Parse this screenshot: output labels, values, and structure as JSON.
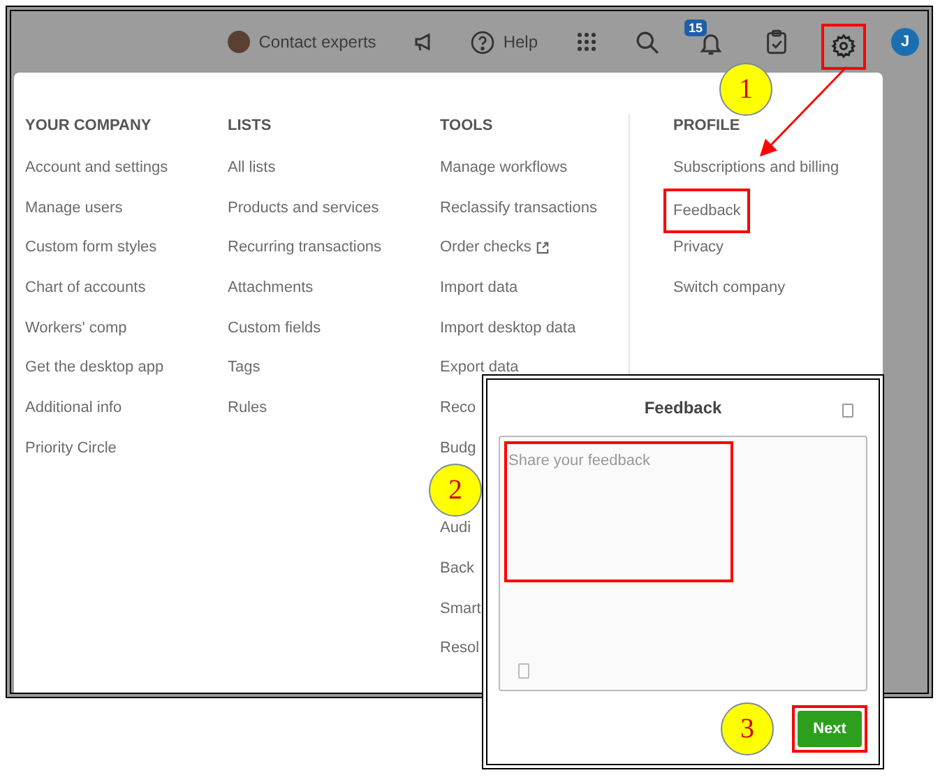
{
  "top_bar": {
    "contact_label": "Contact experts",
    "help_label": "Help",
    "notification_count": "15",
    "avatar_initial": "J"
  },
  "menu": {
    "columns": [
      {
        "heading": "YOUR COMPANY",
        "items": [
          {
            "label": "Account and settings"
          },
          {
            "label": "Manage users"
          },
          {
            "label": "Custom form styles"
          },
          {
            "label": "Chart of accounts"
          },
          {
            "label": "Workers' comp"
          },
          {
            "label": "Get the desktop app"
          },
          {
            "label": "Additional info"
          },
          {
            "label": "Priority Circle"
          }
        ]
      },
      {
        "heading": "LISTS",
        "items": [
          {
            "label": "All lists"
          },
          {
            "label": "Products and services"
          },
          {
            "label": "Recurring transactions"
          },
          {
            "label": "Attachments"
          },
          {
            "label": "Custom fields"
          },
          {
            "label": "Tags"
          },
          {
            "label": "Rules"
          }
        ]
      },
      {
        "heading": "TOOLS",
        "items": [
          {
            "label": "Manage workflows"
          },
          {
            "label": "Reclassify transactions"
          },
          {
            "label": "Order checks",
            "external": true
          },
          {
            "label": "Import data"
          },
          {
            "label": "Import desktop data"
          },
          {
            "label": "Export data"
          },
          {
            "label": "Reco"
          },
          {
            "label": "Budg"
          },
          {
            "label": "Audi"
          },
          {
            "label": "Back"
          },
          {
            "label": "Smart"
          },
          {
            "label": "Resol"
          }
        ]
      },
      {
        "heading": "PROFILE",
        "items": [
          {
            "label": "Subscriptions and billing"
          },
          {
            "label": "Feedback",
            "highlighted": true
          },
          {
            "label": "Privacy"
          },
          {
            "label": "Switch company"
          }
        ]
      }
    ]
  },
  "feedback_dialog": {
    "title": "Feedback",
    "placeholder": "Share your feedback",
    "next_button": "Next"
  },
  "callouts": [
    "1",
    "2",
    "3"
  ]
}
